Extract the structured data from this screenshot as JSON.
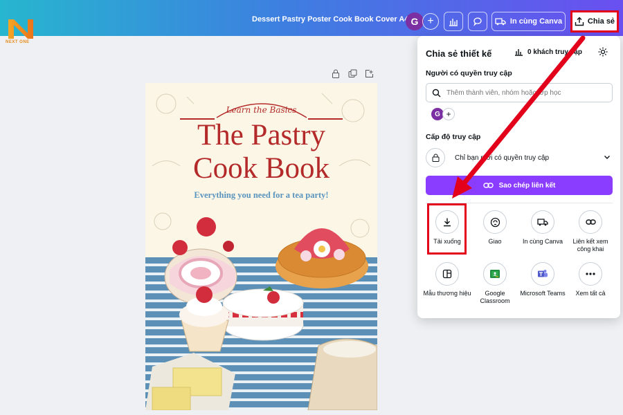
{
  "logo": {
    "text": "NEXT ONE"
  },
  "topbar": {
    "doc_title": "Dessert Pastry Poster Cook Book Cover A4",
    "avatar_initial": "G",
    "print_label": "In cùng Canva",
    "share_label": "Chia sẻ"
  },
  "poster": {
    "tagline": "Learn the Basics",
    "title_line1": "The Pastry",
    "title_line2": "Cook Book",
    "subtitle": "Everything you need for a tea party!"
  },
  "share_panel": {
    "title": "Chia sẻ thiết kế",
    "viewers": "0 khách truy cập",
    "people_label": "Người có quyền truy cập",
    "search_placeholder": "Thêm thành viên, nhóm hoặc lớp học",
    "avatar_initial": "G",
    "access_label": "Cấp độ truy cập",
    "access_value": "Chỉ bạn mới có quyền truy cập",
    "copy_link": "Sao chép liên kết",
    "options": [
      {
        "label": "Tải xuống",
        "icon": "download-icon"
      },
      {
        "label": "Giao",
        "icon": "assign-icon"
      },
      {
        "label": "In cùng Canva",
        "icon": "truck-icon"
      },
      {
        "label": "Liên kết xem công khai",
        "icon": "link-icon"
      },
      {
        "label": "Mẫu thương hiệu",
        "icon": "template-icon"
      },
      {
        "label": "Google Classroom",
        "icon": "google-classroom-icon"
      },
      {
        "label": "Microsoft Teams",
        "icon": "teams-icon"
      },
      {
        "label": "Xem tất cả",
        "icon": "more-icon"
      }
    ]
  },
  "colors": {
    "accent": "#8b3dff",
    "annotation": "#e3001b",
    "poster_red": "#b42a2a",
    "poster_blue": "#5d90b6"
  }
}
